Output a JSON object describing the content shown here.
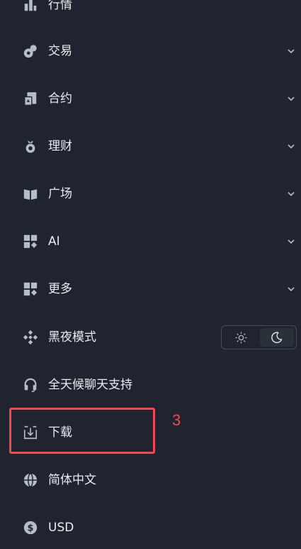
{
  "menu": {
    "items": [
      {
        "label": "行情",
        "icon": "bar-chart-icon",
        "chevron": false
      },
      {
        "label": "交易",
        "icon": "coins-icon",
        "chevron": true
      },
      {
        "label": "合约",
        "icon": "contract-icon",
        "chevron": true
      },
      {
        "label": "理财",
        "icon": "piggy-bank-icon",
        "chevron": true
      },
      {
        "label": "广场",
        "icon": "book-icon",
        "chevron": true
      },
      {
        "label": "AI",
        "icon": "grid-sparkle-icon",
        "chevron": true
      },
      {
        "label": "更多",
        "icon": "grid-sparkle-icon",
        "chevron": true
      },
      {
        "label": "黑夜模式",
        "icon": "binance-logo-icon",
        "chevron": false
      },
      {
        "label": "全天候聊天支持",
        "icon": "headset-icon",
        "chevron": false
      },
      {
        "label": "下载",
        "icon": "download-icon",
        "chevron": false
      },
      {
        "label": "简体中文",
        "icon": "globe-icon",
        "chevron": false
      },
      {
        "label": "USD",
        "icon": "dollar-icon",
        "chevron": false
      }
    ]
  },
  "theme_toggle": {
    "options": [
      "sun-icon",
      "moon-icon"
    ],
    "selected": "moon-icon"
  },
  "annotation": {
    "number": "3",
    "highlighted_item": "下载"
  },
  "colors": {
    "background": "#1f2430",
    "text": "#eaecef",
    "icon": "#b7bdc6",
    "highlight": "#f0494e"
  }
}
